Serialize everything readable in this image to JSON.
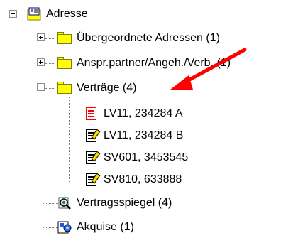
{
  "tree": {
    "root": {
      "label": "Adresse",
      "icon": "address-card-icon",
      "expanded": true
    },
    "children": [
      {
        "label": "Übergeordnete Adressen (1)",
        "icon": "folder-icon",
        "expander": "plus"
      },
      {
        "label": "Anspr.partner/Angeh./Verb. (1)",
        "icon": "folder-icon",
        "expander": "plus"
      },
      {
        "label": "Verträge (4)",
        "icon": "folder-icon",
        "expander": "minus",
        "items": [
          {
            "label": "LV11, 234284 A",
            "icon": "red-document-icon"
          },
          {
            "label": "LV11, 234284 B",
            "icon": "edit-document-icon"
          },
          {
            "label": "SV601, 3453545",
            "icon": "edit-document-icon"
          },
          {
            "label": "SV810, 633888",
            "icon": "edit-document-icon"
          }
        ]
      },
      {
        "label": "Vertragsspiegel (4)",
        "icon": "magnifier-icon"
      },
      {
        "label": "Akquise (1)",
        "icon": "acquisition-icon"
      }
    ]
  },
  "annotation": {
    "icon": "red-arrow-icon",
    "color": "#ff0000"
  },
  "colors": {
    "folder": "#ffff00",
    "arrow": "#ff0000"
  }
}
